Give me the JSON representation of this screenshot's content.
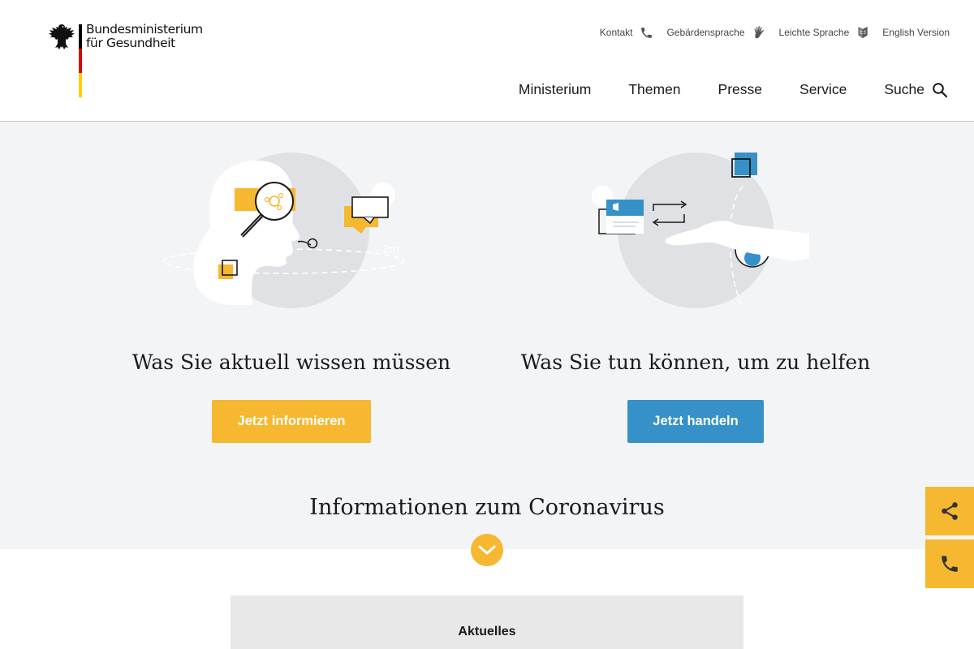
{
  "header": {
    "logo_line1": "Bundesministerium",
    "logo_line2": "für Gesundheit",
    "utility": [
      {
        "label": "Kontakt",
        "icon": "phone-icon"
      },
      {
        "label": "Gebärdensprache",
        "icon": "sign-language-hand-icon"
      },
      {
        "label": "Leichte Sprache",
        "icon": "easy-language-book-icon"
      },
      {
        "label": "English Version",
        "icon": ""
      }
    ],
    "nav": [
      "Ministerium",
      "Themen",
      "Presse",
      "Service"
    ],
    "search_label": "Suche"
  },
  "hero": {
    "left": {
      "title": "Was Sie aktuell wissen müssen",
      "button": "Jetzt informieren",
      "illustration_text": "2m"
    },
    "right": {
      "title": "Was Sie tun können, um zu helfen",
      "button": "Jetzt handeln"
    },
    "section_title": "Informationen zum Coronavirus"
  },
  "content": {
    "box_title": "Aktuelles"
  },
  "colors": {
    "accent_yellow": "#f5b830",
    "accent_blue": "#3591c7",
    "hero_bg": "#f3f4f6",
    "flag_black": "#000000",
    "flag_red": "#dd0000",
    "flag_gold": "#ffcc00"
  },
  "side_actions": [
    {
      "icon": "share-icon"
    },
    {
      "icon": "phone-icon"
    }
  ]
}
